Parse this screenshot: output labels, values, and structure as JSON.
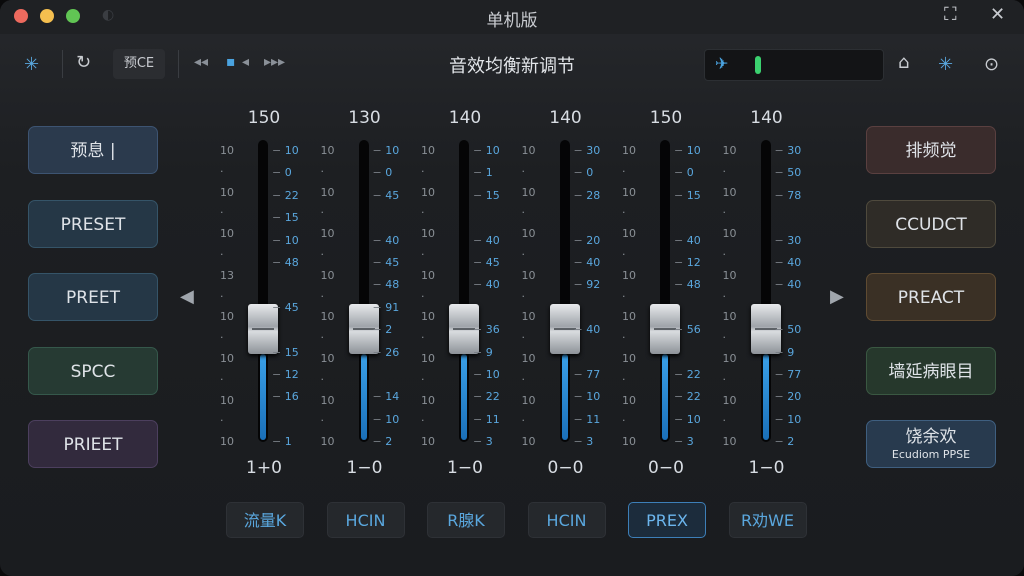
{
  "window": {
    "title": "单机版",
    "ghost_icon": "app-icon",
    "fullscreen_glyph": "⛶",
    "close_glyph": "✕"
  },
  "toolbar": {
    "preset_chip": "预CE",
    "panel_title": "音效均衡新调节",
    "transport": {
      "rewind": "◂◂",
      "dot": "▪",
      "back": "◂",
      "forward": "▸▸▸"
    }
  },
  "meter": {
    "level": 0.05,
    "color": "#3bd16f"
  },
  "left_buttons": [
    {
      "label": "预息 |",
      "bg": "#2b3a4d",
      "border": "#3d5472"
    },
    {
      "label": "PRESET",
      "bg": "#253746",
      "border": "#355468"
    },
    {
      "label": "PREET",
      "bg": "#253746",
      "border": "#355468"
    },
    {
      "label": "SPCC",
      "bg": "#263a33",
      "border": "#35584b"
    },
    {
      "label": "PRIEET",
      "bg": "#322a3d",
      "border": "#4c3f5e"
    }
  ],
  "right_buttons": [
    {
      "label": "排频觉",
      "bg": "#3a2c2c",
      "border": "#5a4040",
      "sub": ""
    },
    {
      "label": "CCUDCT",
      "bg": "#2f2c27",
      "border": "#4f4a3d",
      "sub": ""
    },
    {
      "label": "PREACT",
      "bg": "#3a3025",
      "border": "#5f4b32",
      "sub": ""
    },
    {
      "label": "墙延病眼目",
      "bg": "#26382c",
      "border": "#3a5842",
      "sub": ""
    },
    {
      "label": "饶余欢",
      "bg": "#283a4e",
      "border": "#3f5f80",
      "sub": "Ecudiom PPSE"
    }
  ],
  "nav": {
    "prev": "◀",
    "next": "▶"
  },
  "channels": [
    {
      "top": "150",
      "bottom": "1+0",
      "level": 0.44,
      "tag": "流量K",
      "active": false,
      "left": [
        "10",
        "·",
        "10",
        "·",
        "10",
        "·",
        "13",
        "·",
        "10",
        "·",
        "10",
        "·",
        "10",
        "·",
        "10"
      ],
      "right": [
        "10",
        "0",
        "22",
        "15",
        "10",
        "48",
        "",
        "45",
        "",
        "15",
        "12",
        "16",
        "",
        "1"
      ]
    },
    {
      "top": "130",
      "bottom": "1−0",
      "level": 0.44,
      "tag": "HCIN",
      "active": false,
      "left": [
        "10",
        "·",
        "10",
        "·",
        "10",
        "·",
        "10",
        "·",
        "10",
        "·",
        "10",
        "·",
        "10",
        "·",
        "10"
      ],
      "right": [
        "10",
        "0",
        "45",
        "",
        "40",
        "45",
        "48",
        "91",
        "2",
        "26",
        "",
        "14",
        "10",
        "2"
      ]
    },
    {
      "top": "140",
      "bottom": "1−0",
      "level": 0.44,
      "tag": "R腺K",
      "active": false,
      "left": [
        "10",
        "·",
        "10",
        "·",
        "10",
        "·",
        "10",
        "·",
        "10",
        "·",
        "10",
        "·",
        "10",
        "·",
        "10"
      ],
      "right": [
        "10",
        "1",
        "15",
        "",
        "40",
        "45",
        "40",
        "",
        "36",
        "9",
        "10",
        "22",
        "11",
        "3"
      ]
    },
    {
      "top": "140",
      "bottom": "0−0",
      "level": 0.44,
      "tag": "HCIN",
      "active": false,
      "left": [
        "10",
        "·",
        "10",
        "·",
        "10",
        "·",
        "10",
        "·",
        "10",
        "·",
        "10",
        "·",
        "10",
        "·",
        "10"
      ],
      "right": [
        "30",
        "0",
        "28",
        "",
        "20",
        "40",
        "92",
        "",
        "40",
        "",
        "77",
        "10",
        "11",
        "3"
      ]
    },
    {
      "top": "150",
      "bottom": "0−0",
      "level": 0.44,
      "tag": "PREX",
      "active": true,
      "left": [
        "10",
        "·",
        "10",
        "·",
        "10",
        "·",
        "10",
        "·",
        "10",
        "·",
        "10",
        "·",
        "10",
        "·",
        "10"
      ],
      "right": [
        "10",
        "0",
        "15",
        "",
        "40",
        "12",
        "48",
        "",
        "56",
        "",
        "22",
        "22",
        "10",
        "3"
      ]
    },
    {
      "top": "140",
      "bottom": "1−0",
      "level": 0.44,
      "tag": "R劝WE",
      "active": false,
      "left": [
        "10",
        "·",
        "10",
        "·",
        "10",
        "·",
        "10",
        "·",
        "10",
        "·",
        "10",
        "·",
        "10",
        "·",
        "10"
      ],
      "right": [
        "30",
        "50",
        "78",
        "",
        "30",
        "40",
        "40",
        "",
        "50",
        "9",
        "77",
        "20",
        "10",
        "2"
      ]
    }
  ]
}
